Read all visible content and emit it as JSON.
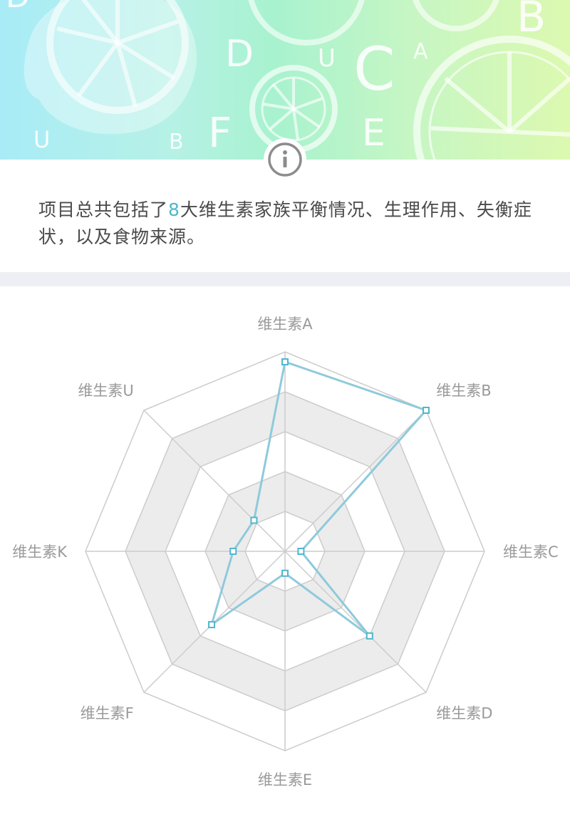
{
  "banner": {
    "letters": [
      "D",
      "D",
      "U",
      "C",
      "A",
      "B",
      "U",
      "B",
      "F",
      "E"
    ]
  },
  "info": {
    "icon": "info-circle-icon"
  },
  "description": {
    "before": "项目总共包括了",
    "count": "8",
    "after": "大维生素家族平衡情况、生理作用、失衡症状，以及食物来源。"
  },
  "colors": {
    "accent": "#4fb7cd",
    "series_line": "#8ecadb",
    "grid": "#cccccc",
    "band": "#ececec"
  },
  "chart_data": {
    "type": "radar",
    "axes": [
      "维生素A",
      "维生素B",
      "维生素C",
      "维生素D",
      "维生素E",
      "维生素F",
      "维生素K",
      "维生素U"
    ],
    "series": [
      {
        "values": [
          0.95,
          1.0,
          0.08,
          0.6,
          0.11,
          0.52,
          0.26,
          0.22
        ]
      }
    ],
    "range": [
      0,
      1
    ],
    "levels": 5
  }
}
